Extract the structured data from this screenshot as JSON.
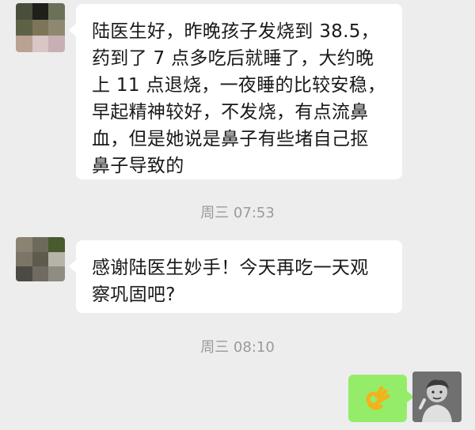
{
  "messages": [
    {
      "text": "陆医生好，昨晚孩子发烧到 38.5，\n药到了 7 点多吃后就睡了，大约晚\n上 11 点退烧，一夜睡的比较安稳，\n早起精神较好，不发烧，有点流鼻\n血，但是她说是鼻子有些堵自己抠\n鼻子导致的"
    },
    {
      "text": "感谢陆医生妙手！今天再吃一天观\n察巩固吧?"
    }
  ],
  "timestamps": [
    "周三 07:53",
    "周三 08:10"
  ],
  "my_message": {
    "emoji": "ok-hand-emoji"
  },
  "colors": {
    "background": "#ededed",
    "incoming_bubble": "#ffffff",
    "outgoing_bubble": "#95ec69",
    "timestamp_text": "#9a9a9a"
  }
}
